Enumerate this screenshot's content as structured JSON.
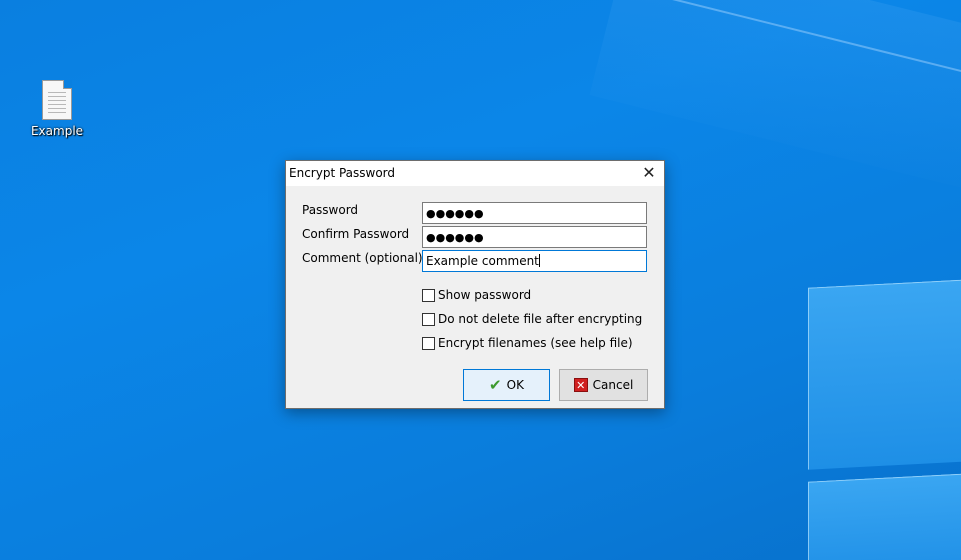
{
  "desktop": {
    "icons": [
      {
        "label": "Example",
        "icon": "text-file-icon"
      }
    ]
  },
  "dialog": {
    "title": "Encrypt Password",
    "close_glyph": "✕",
    "fields": {
      "password": {
        "label": "Password",
        "value": "●●●●●●"
      },
      "confirm": {
        "label": "Confirm Password",
        "value": "●●●●●●"
      },
      "comment": {
        "label": "Comment (optional)",
        "value": "Example comment"
      }
    },
    "options": [
      {
        "label": "Show password",
        "checked": false
      },
      {
        "label": "Do not delete file after encrypting",
        "checked": false
      },
      {
        "label": "Encrypt filenames (see help file)",
        "checked": false
      }
    ],
    "buttons": {
      "ok": {
        "label": "OK",
        "icon": "checkmark-icon",
        "icon_glyph": "✔"
      },
      "cancel": {
        "label": "Cancel",
        "icon": "cancel-x-icon",
        "icon_glyph": "✕"
      }
    }
  },
  "colors": {
    "desktop_bg": "#0a80e0",
    "ok_check": "#3c9a2e",
    "cancel_red": "#d02020",
    "focus_border": "#0078d7"
  }
}
